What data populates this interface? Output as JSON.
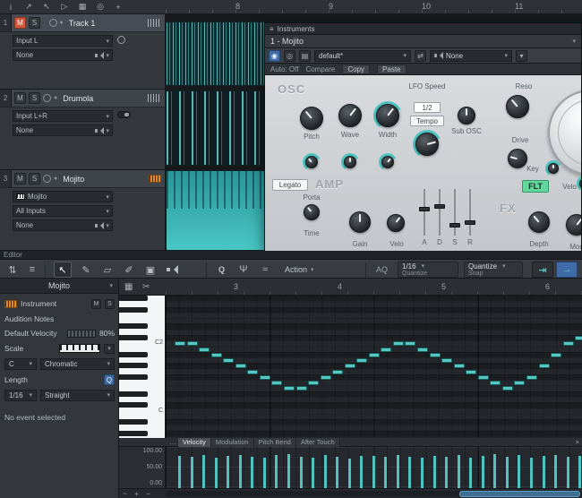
{
  "icons": {
    "caret": "▾",
    "hamburger": "≡",
    "close": "×",
    "more": "…",
    "power": "◉",
    "monitor": "◎",
    "file": "▤",
    "swap": "⇄",
    "info": "i",
    "tools": "↗",
    "cursor": "↖",
    "flag": "▷",
    "mixer": "▦",
    "target": "◎",
    "plus": "+",
    "minus": "−",
    "updown": "⇅",
    "list": "≡",
    "arrow": "↖",
    "pencil": "✎",
    "eraser": "▱",
    "paint": "✐",
    "mute": "▣",
    "q_wand": "Ψ",
    "squiggle": "≈",
    "to_end": "⇥",
    "to_next": "→",
    "wave": "~",
    "scissors": "✂",
    "keys": "▦"
  },
  "top_toolbar": {
    "ruler_numbers": [
      "8",
      "9",
      "10",
      "11"
    ]
  },
  "tracks": [
    {
      "num": "1",
      "mute": "M",
      "solo": "S",
      "name": "Track 1",
      "input": "Input L",
      "output": "None"
    },
    {
      "num": "2",
      "mute": "M",
      "solo": "S",
      "name": "Drumola",
      "input": "Input L+R",
      "output": "None"
    },
    {
      "num": "3",
      "mute": "M",
      "solo": "S",
      "name": "Mojito",
      "instrument": "Mojito",
      "input": "All Inputs",
      "output": "None"
    }
  ],
  "instruments_panel": {
    "title": "Instruments",
    "slot": "1 - Mojito",
    "preset": "default*",
    "output": "None",
    "auto": "Auto: Off",
    "compare": "Compare",
    "copy": "Copy",
    "paste": "Paste",
    "synth": {
      "osc": "OSC",
      "pitch": "Pitch",
      "wave": "Wave",
      "width": "Width",
      "lfo": "LFO Speed",
      "lfo_value": "1/2",
      "tempo": "Tempo",
      "sub": "Sub OSC",
      "legato": "Legato",
      "amp": "AMP",
      "porta": "Porta",
      "time": "Time",
      "gain": "Gain",
      "velo": "Velo",
      "env": [
        "A",
        "D",
        "S",
        "R"
      ],
      "reso": "Reso",
      "drive": "Drive",
      "key": "Key",
      "flt": "FLT",
      "velo2": "Velo",
      "fx": "FX",
      "depth": "Depth",
      "mod": "Mod"
    }
  },
  "editor": {
    "label": "Editor",
    "q": "Q",
    "action": "Action",
    "aq": "AQ",
    "quantize_value": "1/16",
    "quantize_caption": "Quantize",
    "snap_value": "Quantize",
    "snap_caption": "Snap"
  },
  "inspector": {
    "title": "Mojito",
    "instrument": "Instrument",
    "m": "M",
    "s": "S",
    "audition": "Audition Notes",
    "default_velocity": "Default Velocity",
    "velocity_value": "80%",
    "scale": "Scale",
    "root": "C",
    "scale_type": "Chromatic",
    "length": "Length",
    "q": "Q",
    "grid": "1/16",
    "swing": "Straight",
    "status": "No event selected"
  },
  "piano_roll": {
    "ruler_numbers": [
      "3",
      "4",
      "5",
      "6"
    ],
    "key_labels": [
      {
        "text": "C2",
        "row": 8
      },
      {
        "text": "C",
        "row": 20
      }
    ],
    "black_rows": [
      0,
      2,
      5,
      7,
      10,
      12,
      14,
      17,
      19,
      22,
      24
    ],
    "row_height": 6.28,
    "step_width": 13.55,
    "notes": [
      {
        "step": 0,
        "row": 8
      },
      {
        "step": 1,
        "row": 8
      },
      {
        "step": 2,
        "row": 9
      },
      {
        "step": 3,
        "row": 10
      },
      {
        "step": 4,
        "row": 11
      },
      {
        "step": 5,
        "row": 12
      },
      {
        "step": 6,
        "row": 13
      },
      {
        "step": 7,
        "row": 14
      },
      {
        "step": 8,
        "row": 15
      },
      {
        "step": 9,
        "row": 16
      },
      {
        "step": 10,
        "row": 16
      },
      {
        "step": 11,
        "row": 15
      },
      {
        "step": 12,
        "row": 14
      },
      {
        "step": 13,
        "row": 13
      },
      {
        "step": 14,
        "row": 12
      },
      {
        "step": 15,
        "row": 11
      },
      {
        "step": 16,
        "row": 10
      },
      {
        "step": 17,
        "row": 9
      },
      {
        "step": 18,
        "row": 8
      },
      {
        "step": 19,
        "row": 8
      },
      {
        "step": 20,
        "row": 9
      },
      {
        "step": 21,
        "row": 10
      },
      {
        "step": 22,
        "row": 11
      },
      {
        "step": 23,
        "row": 12
      },
      {
        "step": 24,
        "row": 13
      },
      {
        "step": 25,
        "row": 14
      },
      {
        "step": 26,
        "row": 15
      },
      {
        "step": 27,
        "row": 16
      },
      {
        "step": 28,
        "row": 15
      },
      {
        "step": 29,
        "row": 14
      },
      {
        "step": 30,
        "row": 12
      },
      {
        "step": 31,
        "row": 10
      },
      {
        "step": 32,
        "row": 8
      },
      {
        "step": 33,
        "row": 7
      }
    ]
  },
  "velocity_lane": {
    "tabs": [
      "Velocity",
      "Modulation",
      "Pitch Bend",
      "After Touch"
    ],
    "active_tab": "Velocity",
    "scale": [
      "100.00",
      "50.00",
      "0.00"
    ],
    "values": [
      82,
      80,
      84,
      78,
      81,
      85,
      79,
      77,
      83,
      86,
      80,
      78,
      84,
      80,
      76,
      82,
      81,
      79,
      85,
      80,
      77,
      82,
      80,
      84,
      78,
      81,
      86,
      79,
      83,
      77,
      81,
      85,
      80,
      82
    ]
  }
}
